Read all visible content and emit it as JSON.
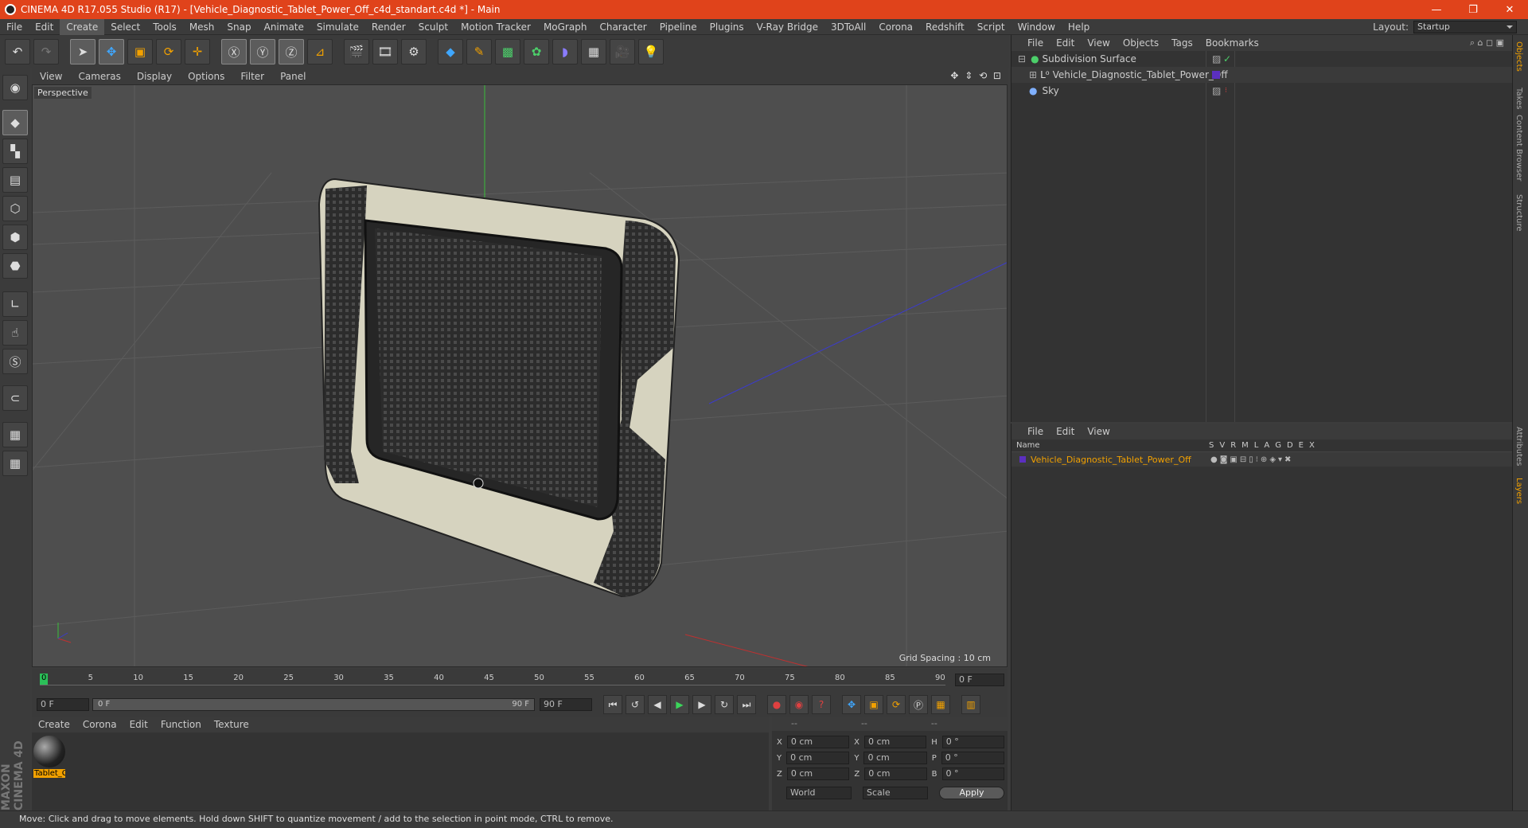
{
  "window": {
    "title": "CINEMA 4D R17.055 Studio (R17) - [Vehicle_Diagnostic_Tablet_Power_Off_c4d_standart.c4d *] - Main",
    "controls": [
      "—",
      "❐",
      "✕"
    ]
  },
  "menu": [
    "File",
    "Edit",
    "Create",
    "Select",
    "Tools",
    "Mesh",
    "Snap",
    "Animate",
    "Simulate",
    "Render",
    "Sculpt",
    "Motion Tracker",
    "MoGraph",
    "Character",
    "Pipeline",
    "Plugins",
    "V-Ray Bridge",
    "3DToAll",
    "Corona",
    "Redshift",
    "Script",
    "Window",
    "Help"
  ],
  "layout": {
    "label": "Layout:",
    "value": "Startup"
  },
  "viewport": {
    "menu": [
      "View",
      "Cameras",
      "Display",
      "Options",
      "Filter",
      "Panel"
    ],
    "label": "Perspective",
    "grid_spacing": "Grid Spacing : 10 cm",
    "nav": "✥ ⇕ ⟲ ⊡"
  },
  "timeline": {
    "ticks": [
      "0",
      "5",
      "10",
      "15",
      "20",
      "25",
      "30",
      "35",
      "40",
      "45",
      "50",
      "55",
      "60",
      "65",
      "70",
      "75",
      "80",
      "85",
      "90"
    ],
    "current": "0 F",
    "start": "0 F",
    "range_start": "0 F",
    "range_end": "90 F",
    "end": "90 F"
  },
  "material": {
    "menu": [
      "Create",
      "Corona",
      "Edit",
      "Function",
      "Texture"
    ],
    "item": "Tablet_C"
  },
  "coords": {
    "headers": [
      "--",
      "--",
      "--"
    ],
    "rows": [
      {
        "a": "X",
        "av": "0 cm",
        "b": "X",
        "bv": "0 cm",
        "c": "H",
        "cv": "0 °"
      },
      {
        "a": "Y",
        "av": "0 cm",
        "b": "Y",
        "bv": "0 cm",
        "c": "P",
        "cv": "0 °"
      },
      {
        "a": "Z",
        "av": "0 cm",
        "b": "Z",
        "bv": "0 cm",
        "c": "B",
        "cv": "0 °"
      }
    ],
    "world": "World",
    "scale": "Scale",
    "apply": "Apply"
  },
  "objects": {
    "menu": [
      "File",
      "Edit",
      "View",
      "Objects",
      "Tags",
      "Bookmarks"
    ],
    "items": [
      "Subdivision Surface",
      "Vehicle_Diagnostic_Tablet_Power_Off",
      "Sky"
    ]
  },
  "layers": {
    "menu": [
      "File",
      "Edit",
      "View"
    ],
    "name_header": "Name",
    "flags": [
      "S",
      "V",
      "R",
      "M",
      "L",
      "A",
      "G",
      "D",
      "E",
      "X"
    ],
    "item": "Vehicle_Diagnostic_Tablet_Power_Off"
  },
  "side_tabs": [
    "Objects",
    "Takes",
    "Content Browser",
    "Structure",
    "Attributes",
    "Layers"
  ],
  "brand": "MAXON CINEMA 4D",
  "status": "Move: Click and drag to move elements. Hold down SHIFT to quantize movement / add to the selection in point mode, CTRL to remove.",
  "colors": {
    "title_bar": "#e0431b",
    "accent_orange": "#f2a100",
    "layer_color": "#5b2fc0"
  }
}
